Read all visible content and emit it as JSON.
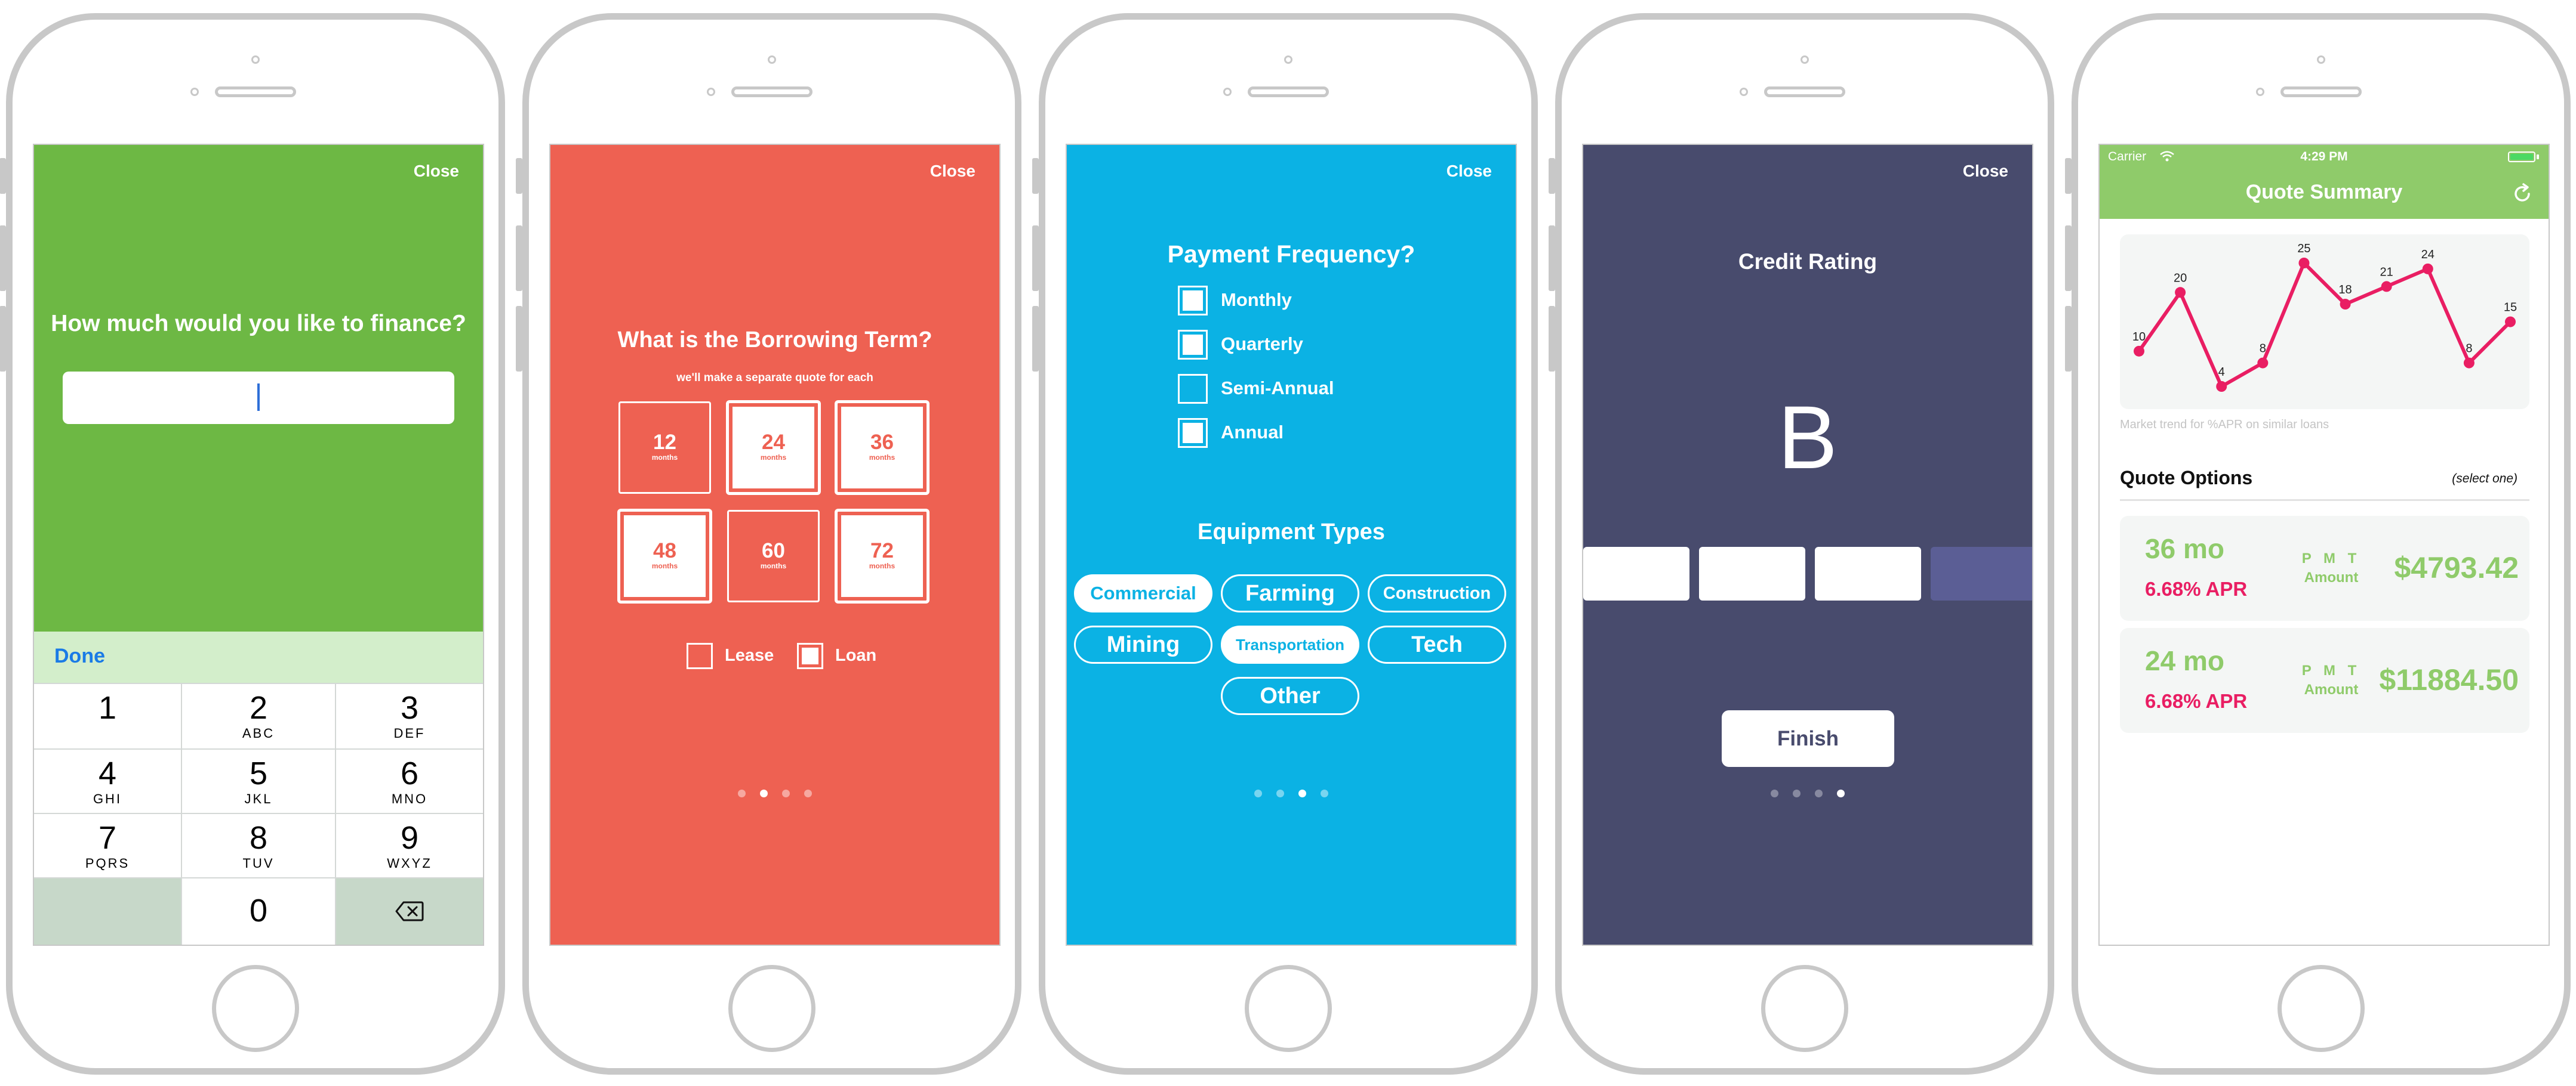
{
  "common": {
    "close_label": "Close"
  },
  "screen1": {
    "question": "How much would you like to finance?",
    "amount_value": "",
    "done_label": "Done",
    "keys": [
      {
        "digit": "1",
        "letters": ""
      },
      {
        "digit": "2",
        "letters": "ABC"
      },
      {
        "digit": "3",
        "letters": "DEF"
      },
      {
        "digit": "4",
        "letters": "GHI"
      },
      {
        "digit": "5",
        "letters": "JKL"
      },
      {
        "digit": "6",
        "letters": "MNO"
      },
      {
        "digit": "7",
        "letters": "PQRS"
      },
      {
        "digit": "8",
        "letters": "TUV"
      },
      {
        "digit": "9",
        "letters": "WXYZ"
      },
      {
        "digit": "0",
        "letters": ""
      }
    ],
    "delete_icon": "backspace-icon",
    "background_color": "#6db844"
  },
  "screen2": {
    "question": "What is the Borrowing Term?",
    "subtitle": "we'll make a separate quote for each",
    "unit_label": "months",
    "terms": [
      {
        "value": "12",
        "selected": false
      },
      {
        "value": "24",
        "selected": true
      },
      {
        "value": "36",
        "selected": true
      },
      {
        "value": "48",
        "selected": true
      },
      {
        "value": "60",
        "selected": false
      },
      {
        "value": "72",
        "selected": true
      }
    ],
    "lease_label": "Lease",
    "lease_checked": false,
    "loan_label": "Loan",
    "loan_checked": true,
    "page_index": 2,
    "page_count": 4,
    "background_color": "#ee6152"
  },
  "screen3": {
    "question": "Payment Frequency?",
    "frequencies": [
      {
        "label": "Monthly",
        "checked": true
      },
      {
        "label": "Quarterly",
        "checked": true
      },
      {
        "label": "Semi-Annual",
        "checked": false
      },
      {
        "label": "Annual",
        "checked": true
      }
    ],
    "equipment_heading": "Equipment Types",
    "equipment": [
      {
        "label": "Commercial",
        "selected": true
      },
      {
        "label": "Farming",
        "selected": false
      },
      {
        "label": "Construction",
        "selected": false
      },
      {
        "label": "Mining",
        "selected": false
      },
      {
        "label": "Transportation",
        "selected": true
      },
      {
        "label": "Tech",
        "selected": false
      },
      {
        "label": "Other",
        "selected": false
      }
    ],
    "page_index": 3,
    "page_count": 4,
    "background_color": "#0bb2e4"
  },
  "screen4": {
    "question": "Credit Rating",
    "grade": "B",
    "rating_level": 3,
    "rating_count": 4,
    "finish_label": "Finish",
    "page_index": 4,
    "page_count": 4,
    "background_color": "#484b6d"
  },
  "screen5": {
    "carrier": "Carrier",
    "time": "4:29 PM",
    "title": "Quote Summary",
    "refresh_icon": "refresh-icon",
    "chart_caption": "Market trend for %APR on similar loans",
    "quote_options_label": "Quote Options",
    "select_one_label": "(select one)",
    "pmt_label": "P M T",
    "amount_label": "Amount",
    "quotes": [
      {
        "term": "36 mo",
        "apr": "6.68% APR",
        "payment": "$4793.42"
      },
      {
        "term": "24 mo",
        "apr": "6.68% APR",
        "payment": "$11884.50"
      }
    ],
    "accent_color": "#8fcb6a",
    "highlight_color": "#e91e63"
  },
  "chart_data": {
    "type": "line",
    "x": [
      1,
      2,
      3,
      4,
      5,
      6,
      7,
      8,
      9,
      10
    ],
    "values": [
      10,
      20,
      4,
      8,
      25,
      18,
      21,
      24,
      8,
      15
    ],
    "data_labels": [
      "10",
      "20",
      "4",
      "8",
      "25",
      "18",
      "21",
      "24",
      "8",
      "15"
    ],
    "title": "",
    "xlabel": "",
    "ylabel": "",
    "grid": false,
    "color": "#e91e63"
  }
}
